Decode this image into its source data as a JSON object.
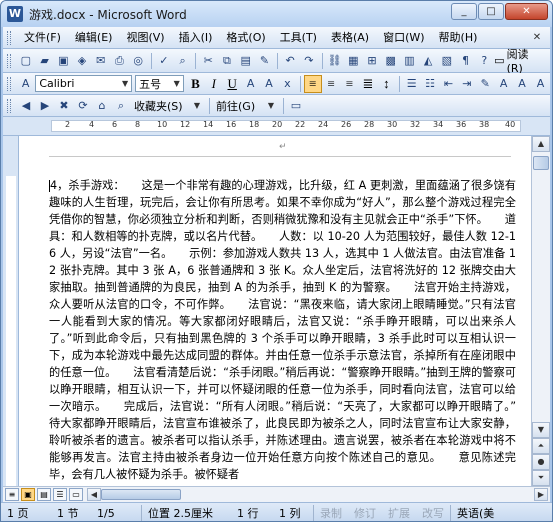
{
  "window": {
    "title": "游戏.docx - Microsoft Word",
    "minimize": "_",
    "maximize": "□",
    "close": "✕"
  },
  "menubar": {
    "items": [
      "文件(F)",
      "编辑(E)",
      "视图(V)",
      "插入(I)",
      "格式(O)",
      "工具(T)",
      "表格(A)",
      "窗口(W)",
      "帮助(H)"
    ],
    "close_doc": "✕"
  },
  "toolbar_standard": {
    "reading_label": "阅读(R)"
  },
  "toolbar_format": {
    "font_name": "Calibri",
    "font_size": "五号",
    "bold": "B",
    "italic": "I",
    "underline": "U"
  },
  "toolbar_web": {
    "favorites_label": "收藏夹(S)",
    "goto_label": "前往(G)"
  },
  "ruler": {
    "h_ticks": [
      "2",
      "4",
      "6",
      "8",
      "10",
      "12",
      "14",
      "16",
      "18",
      "20",
      "22",
      "24",
      "26",
      "28",
      "30",
      "32",
      "34",
      "36",
      "38",
      "40"
    ]
  },
  "document": {
    "paragraph_mark": "↵",
    "body": "4，杀手游戏：　　这是一个非常有趣的心理游戏，比升级，红 A 更刺激，里面蕴涵了很多饶有趣味的人生哲理，玩完后，会让你有所思考。如果不幸你成为“好人”，那么整个游戏过程完全凭借你的智慧，你必须独立分析和判断，否则稍微犹豫和没有主见就会正中“杀手”下怀。　　道具：和人数相等的扑克牌，或以名片代替。　　人数：以 10-20 人为范围较好，最佳人数 12-16 人，另设“法官”一名。　　示例：参加游戏人数共 13 人，选其中 1 人做法官。由法官准备 12 张扑克牌。其中 3 张 A，6 张普通牌和 3 张 K。众人坐定后，法官将洗好的 12 张牌交由大家抽取。抽到普通牌的为良民，抽到 A 的为杀手，抽到 K 的为警察。　　法官开始主持游戏，众人要听从法官的口令，不可作弊。　　法官说：“黑夜来临，请大家闭上眼睛睡觉。”只有法官一人能看到大家的情况。等大家都闭好眼睛后，法官又说：“杀手睁开眼睛，可以出来杀人了。”听到此命令后，只有抽到黑色牌的 3 个杀手可以睁开眼睛，3 杀手此时可以互相认识一下，成为本轮游戏中最先达成同盟的群体。并由任意一位杀手示意法官，杀掉所有在座闭眼中的任意一位。　　法官看清楚后说：“杀手闭眼。”稍后再说：“警察睁开眼睛。”抽到王牌的警察可以睁开眼睛，相互认识一下，并可以怀疑闭眼的任意一位为杀手，同时看向法官，法官可以给一次暗示。　　完成后，法官说：“所有人闭眼。”稍后说：“天亮了，大家都可以睁开眼睛了。”　　待大家都睁开眼睛后，法官宣布谁被杀了，此良民即为被杀之人，同时法官宣布让大家安静，聆听被杀者的遗言。被杀者可以指认杀手，并陈述理由。遗言说罢，被杀者在本轮游戏中将不能够再发言。法官主持由被杀者身边一位开始任意方向按个陈述自己的意见。　　意见陈述完毕，会有几人被怀疑为杀手。被怀疑者"
  },
  "statusbar": {
    "page": "1 页",
    "section": "1 节",
    "page_of": "1/5",
    "position": "位置 2.5厘米",
    "line": "1 行",
    "column": "1 列",
    "rec": "录制",
    "trk": "修订",
    "ext": "扩展",
    "ovr": "改写",
    "language": "英语(美"
  }
}
